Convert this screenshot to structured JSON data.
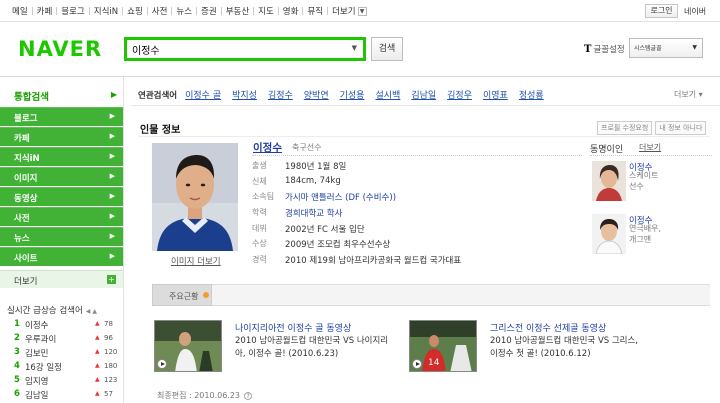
{
  "top_nav": {
    "items": [
      "메일",
      "카페",
      "블로그",
      "지식iN",
      "쇼핑",
      "사전",
      "뉴스",
      "증권",
      "부동산",
      "지도",
      "영화",
      "뮤직",
      "더보기"
    ],
    "login_label": "로그인",
    "naverme_label": "네이버"
  },
  "header": {
    "logo": "NAVER",
    "search_value": "이정수",
    "search_button": "검색",
    "font_setting_icon": "T",
    "font_setting_label": "글꼴설정",
    "font_select_value": "시스템글꼴"
  },
  "sidebar": {
    "total_search": "통합검색",
    "items": [
      "블로그",
      "카페",
      "지식iN",
      "이미지",
      "동영상",
      "사전",
      "뉴스",
      "사이트"
    ],
    "more_label": "더보기",
    "realtime_title": "실시간 급상승 검색어",
    "realtime": [
      {
        "rank": "1",
        "keyword": "이정수",
        "count": "78"
      },
      {
        "rank": "2",
        "keyword": "우루과이",
        "count": "96"
      },
      {
        "rank": "3",
        "keyword": "김보민",
        "count": "120"
      },
      {
        "rank": "4",
        "keyword": "16강 일정",
        "count": "180"
      },
      {
        "rank": "5",
        "keyword": "임지영",
        "count": "123"
      },
      {
        "rank": "6",
        "keyword": "김남일",
        "count": "57"
      }
    ]
  },
  "related": {
    "title": "연관검색어",
    "keywords": [
      "이정수 골",
      "박지성",
      "김정수",
      "양박연",
      "기성용",
      "설시백",
      "김남일",
      "김정우",
      "이영표",
      "정성룡"
    ],
    "more_label": "더보기"
  },
  "profile": {
    "section_title": "인물 정보",
    "edit_request": "프로필 수정요청",
    "add_info": "내 정보 아니다",
    "name": "이정수",
    "job": "축구선수",
    "photo_more": "이미지 더보기",
    "info": [
      {
        "key": "출생",
        "value": "1980년 1월 8일",
        "link": false
      },
      {
        "key": "신체",
        "value": "184cm, 74kg",
        "link": false
      },
      {
        "key": "소속팀",
        "value": "가시마 앤틀러스 (DF (수비수))",
        "link": true
      },
      {
        "key": "학력",
        "value": "경희대학교 학사",
        "link": true
      },
      {
        "key": "데뷔",
        "value": "2002년 FC 서울 입단",
        "link": false
      },
      {
        "key": "수상",
        "value": "2009년 조모컵 최우수선수상",
        "link": false
      },
      {
        "key": "경력",
        "value": "2010 제19회 남아프리카공화국 월드컵 국가대표",
        "link": false
      }
    ]
  },
  "namesakes": {
    "title": "동명이인",
    "more_label": "더보기",
    "people": [
      {
        "name": "이정수",
        "desc": "스케이트 선수"
      },
      {
        "name": "이정수",
        "desc": "연극배우, 개그맨"
      }
    ]
  },
  "tabs": {
    "main": "주요근황"
  },
  "news": [
    {
      "title": "나이지리아전 이정수 골 동영상",
      "desc1": "2010 남아공월드컵 대한민국 VS 나이지리",
      "desc2": "아, 이정수 골! (2010.6.23)"
    },
    {
      "title": "그리스전 이정수 선제골 동영상",
      "desc1": "2010 남아공월드컵 대한민국 VS 그리스,",
      "desc2": "이정수 첫 골! (2010.6.12)"
    }
  ],
  "last_edit": "최종편집 : 2010.06.23",
  "colors": {
    "brand_green": "#1ec800",
    "sidebar_green": "#41b236",
    "link_blue": "#1f3fa0"
  }
}
